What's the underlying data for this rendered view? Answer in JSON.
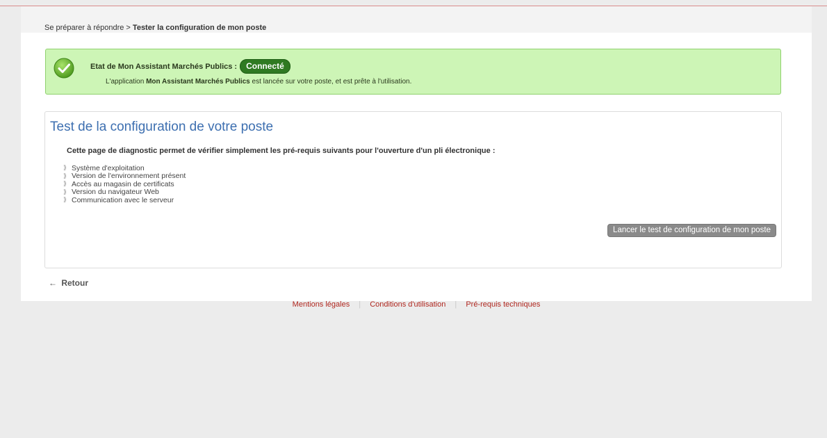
{
  "breadcrumb": {
    "parent": "Se préparer à répondre",
    "separator": ">",
    "current": "Tester la configuration de mon poste"
  },
  "status": {
    "label": "Etat de Mon Assistant Marchés Publics :",
    "badge": "Connecté",
    "message_prefix": "L'application",
    "message_app": "Mon Assistant Marchés Publics",
    "message_suffix": "est lancée sur votre poste, et est prête à l'utilisation.",
    "icon": "check-circle-icon",
    "colors": {
      "background": "#cdf5b6",
      "border": "#8fd16e",
      "badge": "#2f7a22"
    }
  },
  "panel": {
    "title": "Test de la configuration de votre poste",
    "intro": "Cette page de diagnostic permet de vérifier simplement les pré-requis suivants pour l'ouverture d'un pli électronique :",
    "items": [
      "Système d'exploitation",
      "Version de l'environnement présent",
      "Accès au magasin de certificats",
      "Version du navigateur Web",
      "Communication avec le serveur"
    ],
    "launch_button": "Lancer le test de configuration de mon poste"
  },
  "back": {
    "arrow": "←",
    "label": "Retour"
  },
  "footer": {
    "links": [
      "Mentions légales",
      "Conditions d'utilisation",
      "Pré-requis techniques"
    ],
    "link_color": "#b0271f"
  },
  "accent": {
    "title_color": "#3d6fb0"
  }
}
